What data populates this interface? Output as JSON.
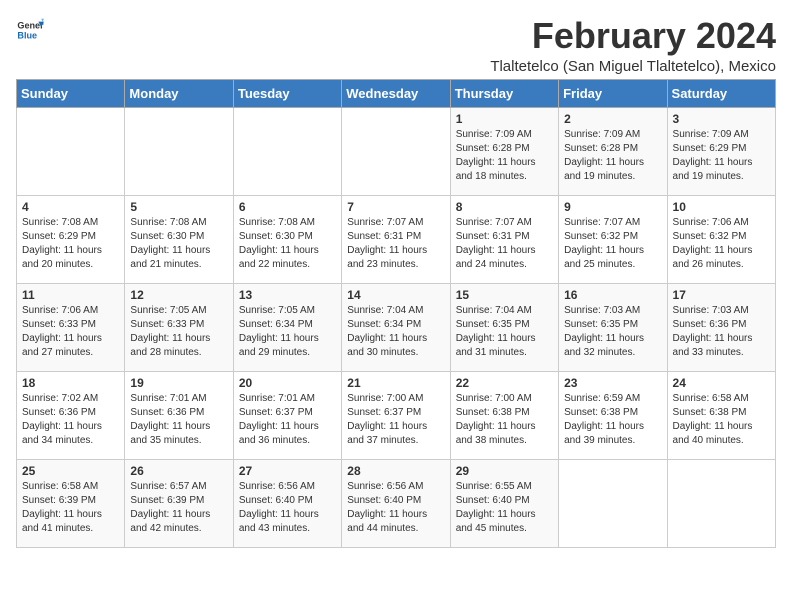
{
  "logo": {
    "general": "General",
    "blue": "Blue"
  },
  "title": "February 2024",
  "subtitle": "Tlaltetelco (San Miguel Tlaltetelco), Mexico",
  "days_header": [
    "Sunday",
    "Monday",
    "Tuesday",
    "Wednesday",
    "Thursday",
    "Friday",
    "Saturday"
  ],
  "weeks": [
    [
      {
        "day": "",
        "details": ""
      },
      {
        "day": "",
        "details": ""
      },
      {
        "day": "",
        "details": ""
      },
      {
        "day": "",
        "details": ""
      },
      {
        "day": "1",
        "details": "Sunrise: 7:09 AM\nSunset: 6:28 PM\nDaylight: 11 hours and 18 minutes."
      },
      {
        "day": "2",
        "details": "Sunrise: 7:09 AM\nSunset: 6:28 PM\nDaylight: 11 hours and 19 minutes."
      },
      {
        "day": "3",
        "details": "Sunrise: 7:09 AM\nSunset: 6:29 PM\nDaylight: 11 hours and 19 minutes."
      }
    ],
    [
      {
        "day": "4",
        "details": "Sunrise: 7:08 AM\nSunset: 6:29 PM\nDaylight: 11 hours and 20 minutes."
      },
      {
        "day": "5",
        "details": "Sunrise: 7:08 AM\nSunset: 6:30 PM\nDaylight: 11 hours and 21 minutes."
      },
      {
        "day": "6",
        "details": "Sunrise: 7:08 AM\nSunset: 6:30 PM\nDaylight: 11 hours and 22 minutes."
      },
      {
        "day": "7",
        "details": "Sunrise: 7:07 AM\nSunset: 6:31 PM\nDaylight: 11 hours and 23 minutes."
      },
      {
        "day": "8",
        "details": "Sunrise: 7:07 AM\nSunset: 6:31 PM\nDaylight: 11 hours and 24 minutes."
      },
      {
        "day": "9",
        "details": "Sunrise: 7:07 AM\nSunset: 6:32 PM\nDaylight: 11 hours and 25 minutes."
      },
      {
        "day": "10",
        "details": "Sunrise: 7:06 AM\nSunset: 6:32 PM\nDaylight: 11 hours and 26 minutes."
      }
    ],
    [
      {
        "day": "11",
        "details": "Sunrise: 7:06 AM\nSunset: 6:33 PM\nDaylight: 11 hours and 27 minutes."
      },
      {
        "day": "12",
        "details": "Sunrise: 7:05 AM\nSunset: 6:33 PM\nDaylight: 11 hours and 28 minutes."
      },
      {
        "day": "13",
        "details": "Sunrise: 7:05 AM\nSunset: 6:34 PM\nDaylight: 11 hours and 29 minutes."
      },
      {
        "day": "14",
        "details": "Sunrise: 7:04 AM\nSunset: 6:34 PM\nDaylight: 11 hours and 30 minutes."
      },
      {
        "day": "15",
        "details": "Sunrise: 7:04 AM\nSunset: 6:35 PM\nDaylight: 11 hours and 31 minutes."
      },
      {
        "day": "16",
        "details": "Sunrise: 7:03 AM\nSunset: 6:35 PM\nDaylight: 11 hours and 32 minutes."
      },
      {
        "day": "17",
        "details": "Sunrise: 7:03 AM\nSunset: 6:36 PM\nDaylight: 11 hours and 33 minutes."
      }
    ],
    [
      {
        "day": "18",
        "details": "Sunrise: 7:02 AM\nSunset: 6:36 PM\nDaylight: 11 hours and 34 minutes."
      },
      {
        "day": "19",
        "details": "Sunrise: 7:01 AM\nSunset: 6:36 PM\nDaylight: 11 hours and 35 minutes."
      },
      {
        "day": "20",
        "details": "Sunrise: 7:01 AM\nSunset: 6:37 PM\nDaylight: 11 hours and 36 minutes."
      },
      {
        "day": "21",
        "details": "Sunrise: 7:00 AM\nSunset: 6:37 PM\nDaylight: 11 hours and 37 minutes."
      },
      {
        "day": "22",
        "details": "Sunrise: 7:00 AM\nSunset: 6:38 PM\nDaylight: 11 hours and 38 minutes."
      },
      {
        "day": "23",
        "details": "Sunrise: 6:59 AM\nSunset: 6:38 PM\nDaylight: 11 hours and 39 minutes."
      },
      {
        "day": "24",
        "details": "Sunrise: 6:58 AM\nSunset: 6:38 PM\nDaylight: 11 hours and 40 minutes."
      }
    ],
    [
      {
        "day": "25",
        "details": "Sunrise: 6:58 AM\nSunset: 6:39 PM\nDaylight: 11 hours and 41 minutes."
      },
      {
        "day": "26",
        "details": "Sunrise: 6:57 AM\nSunset: 6:39 PM\nDaylight: 11 hours and 42 minutes."
      },
      {
        "day": "27",
        "details": "Sunrise: 6:56 AM\nSunset: 6:40 PM\nDaylight: 11 hours and 43 minutes."
      },
      {
        "day": "28",
        "details": "Sunrise: 6:56 AM\nSunset: 6:40 PM\nDaylight: 11 hours and 44 minutes."
      },
      {
        "day": "29",
        "details": "Sunrise: 6:55 AM\nSunset: 6:40 PM\nDaylight: 11 hours and 45 minutes."
      },
      {
        "day": "",
        "details": ""
      },
      {
        "day": "",
        "details": ""
      }
    ]
  ]
}
